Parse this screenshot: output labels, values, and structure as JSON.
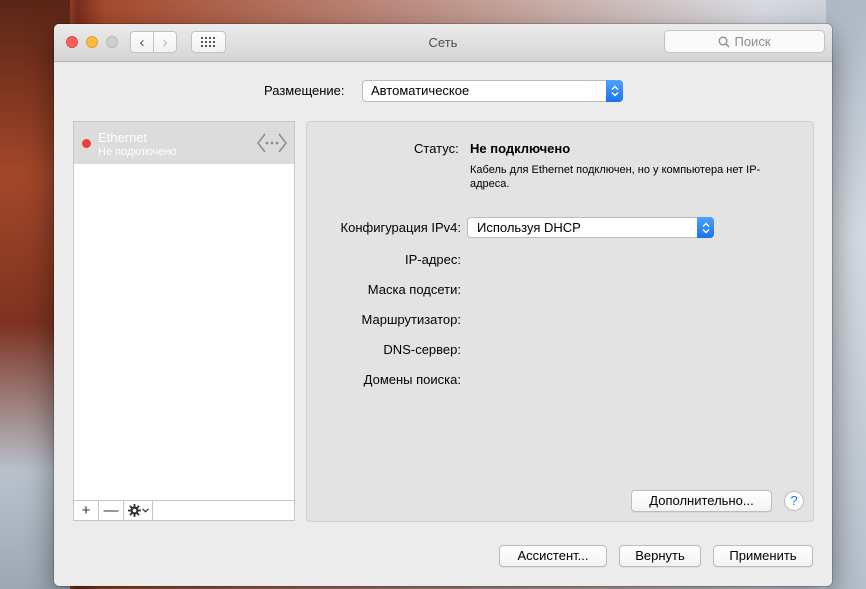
{
  "window": {
    "title": "Сеть",
    "search_placeholder": "Поиск"
  },
  "location": {
    "label": "Размещение:",
    "value": "Автоматическое"
  },
  "services": [
    {
      "name": "Ethernet",
      "status": "Не подключено",
      "status_color": "#ef3e3a"
    }
  ],
  "sidebar_toolbar": {
    "add": "+",
    "remove": "—"
  },
  "detail": {
    "status_label": "Статус:",
    "status_value": "Не подключено",
    "status_description": "Кабель для Ethernet подключен, но у компьютера нет IP-адреса.",
    "ipv4_label": "Конфигурация IPv4:",
    "ipv4_value": "Используя DHCP",
    "ip_label": "IP-адрес:",
    "subnet_label": "Маска подсети:",
    "router_label": "Маршрутизатор:",
    "dns_label": "DNS-сервер:",
    "search_domains_label": "Домены поиска:",
    "advanced_button": "Дополнительно...",
    "help_button": "?"
  },
  "footer": {
    "assistant_button": "Ассистент...",
    "revert_button": "Вернуть",
    "apply_button": "Применить"
  },
  "colors": {
    "accent": "#1a74ec",
    "selection": "#dcdcdc"
  }
}
